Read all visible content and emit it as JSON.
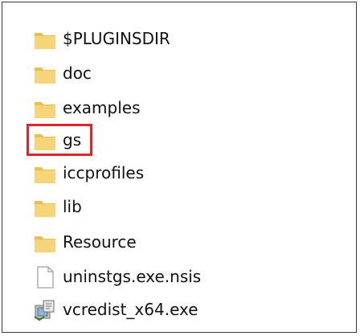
{
  "colors": {
    "folder_fill": "#f5d47a",
    "folder_tab": "#e9bf52",
    "highlight": "#e0242b",
    "border": "#3a3a3a"
  },
  "file_list": {
    "items": [
      {
        "name": "$PLUGINSDIR",
        "icon": "folder-icon",
        "type": "folder"
      },
      {
        "name": "doc",
        "icon": "folder-icon",
        "type": "folder"
      },
      {
        "name": "examples",
        "icon": "folder-icon",
        "type": "folder"
      },
      {
        "name": "gs",
        "icon": "folder-icon",
        "type": "folder",
        "highlighted": true
      },
      {
        "name": "iccprofiles",
        "icon": "folder-icon",
        "type": "folder"
      },
      {
        "name": "lib",
        "icon": "folder-icon",
        "type": "folder"
      },
      {
        "name": "Resource",
        "icon": "folder-icon",
        "type": "folder"
      },
      {
        "name": "uninstgs.exe.nsis",
        "icon": "file-icon",
        "type": "file"
      },
      {
        "name": "vcredist_x64.exe",
        "icon": "installer-icon",
        "type": "file"
      }
    ]
  }
}
